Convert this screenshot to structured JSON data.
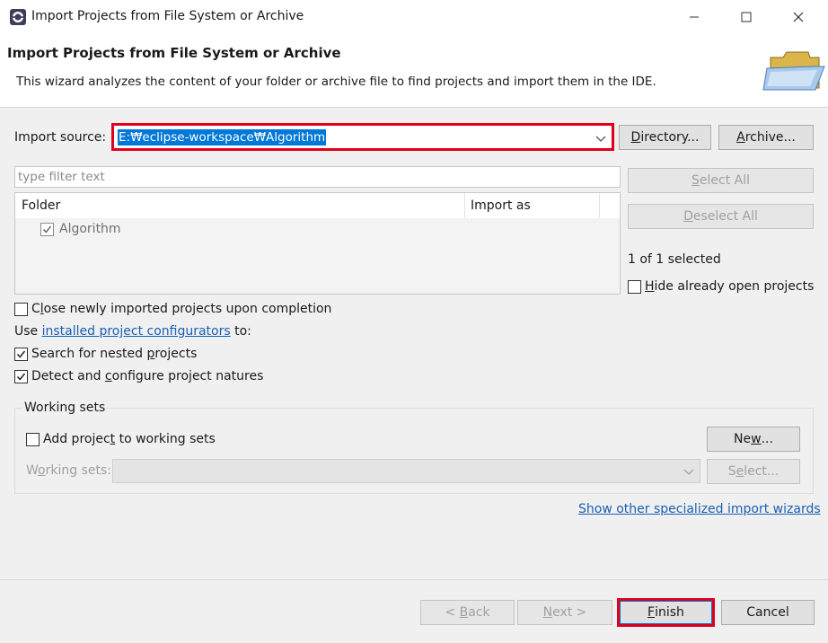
{
  "window": {
    "title": "Import Projects from File System or Archive",
    "icons": {
      "app": "eclipse-icon",
      "minimize": "minimize-icon",
      "maximize": "maximize-icon",
      "close": "close-icon"
    }
  },
  "header": {
    "heading": "Import Projects from File System or Archive",
    "description": "This wizard analyzes the content of your folder or archive file to find projects and import them in the IDE.",
    "banner_icon": "folder-open-icon"
  },
  "source": {
    "label_pre": "Import source:",
    "value": "E:₩eclipse-workspace₩Algorithm",
    "highlight_color": "#e0001b",
    "directory_button": {
      "pre": "",
      "mnemonic": "D",
      "post": "irectory..."
    },
    "archive_button": {
      "pre": "",
      "mnemonic": "A",
      "post": "rchive..."
    }
  },
  "filter": {
    "placeholder": "type filter text"
  },
  "tree": {
    "columns": [
      "Folder",
      "Import as"
    ],
    "rows": [
      {
        "folder": "Algorithm",
        "import_as": "",
        "checked": true
      }
    ]
  },
  "selection": {
    "select_all": {
      "pre": "",
      "mnemonic": "S",
      "post": "elect All"
    },
    "deselect_all": {
      "pre": "",
      "mnemonic": "D",
      "post": "eselect All"
    },
    "count": "1 of 1 selected",
    "hide_open": {
      "pre": "",
      "mnemonic": "H",
      "post": "ide already open projects",
      "checked": false
    }
  },
  "options": {
    "close_after": {
      "pre": "C",
      "mnemonic": "l",
      "post": "ose newly imported projects upon completion",
      "checked": false
    },
    "use_prefix": "Use ",
    "configurators_link": "installed project configurators",
    "use_suffix": " to:",
    "nested": {
      "pre": "Search for nested ",
      "mnemonic": "p",
      "post": "rojects",
      "checked": true
    },
    "detect": {
      "pre": "Detect and ",
      "mnemonic": "c",
      "post": "onfigure project natures",
      "checked": true
    }
  },
  "working_sets": {
    "group_title": "Working sets",
    "add": {
      "pre": "Add projec",
      "mnemonic": "t",
      "post": " to working sets",
      "checked": false
    },
    "new_button": {
      "pre": "Ne",
      "mnemonic": "w",
      "post": "..."
    },
    "sets_label": {
      "pre": "W",
      "mnemonic": "o",
      "post": "rking sets:"
    },
    "select_button": {
      "pre": "S",
      "mnemonic": "e",
      "post": "lect..."
    }
  },
  "other_wizards_link": "Show other specialized import wizards",
  "footer": {
    "back": {
      "pre": "< ",
      "mnemonic": "B",
      "post": "ack"
    },
    "next": {
      "pre": "",
      "mnemonic": "N",
      "post": "ext >"
    },
    "finish": {
      "pre": "",
      "mnemonic": "F",
      "post": "inish"
    },
    "cancel": "Cancel",
    "highlight_color": "#e0001b"
  }
}
